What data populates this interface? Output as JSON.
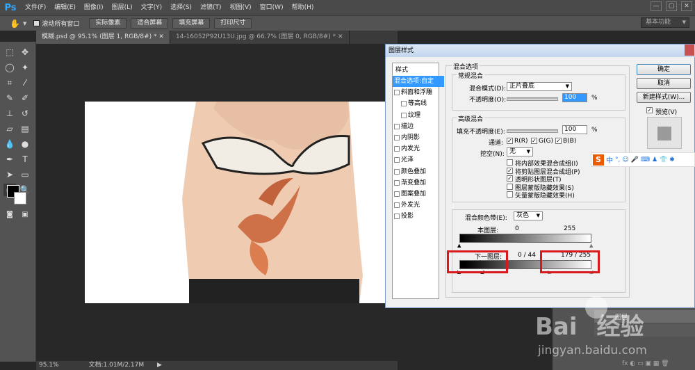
{
  "app": {
    "logo": "Ps"
  },
  "menu": [
    "文件(F)",
    "编辑(E)",
    "图像(I)",
    "图层(L)",
    "文字(Y)",
    "选择(S)",
    "滤镜(T)",
    "视图(V)",
    "窗口(W)",
    "帮助(H)"
  ],
  "window_controls": [
    "—",
    "▢",
    "✕"
  ],
  "options_bar": {
    "scroll_all_label": "滚动所有窗口",
    "buttons": [
      "实际像素",
      "适合屏幕",
      "填充屏幕",
      "打印尺寸"
    ],
    "workspace": "基本功能"
  },
  "tabs": [
    {
      "label": "模糊.psd @ 95.1% (图层 1, RGB/8#) * ✕",
      "active": true
    },
    {
      "label": "14-16052P92U13U.jpg @ 66.7% (图层 0, RGB/8#) * ✕",
      "active": false
    }
  ],
  "status": {
    "zoom": "95.1%",
    "doc": "文档:1.01M/2.17M"
  },
  "dialog": {
    "title": "图层样式",
    "styles_header": "样式",
    "styles": [
      {
        "label": "混合选项:自定",
        "selected": true,
        "checkbox": false
      },
      {
        "label": "斜面和浮雕",
        "checkbox": true
      },
      {
        "label": "等高线",
        "checkbox": true,
        "indent": true
      },
      {
        "label": "纹理",
        "checkbox": true,
        "indent": true
      },
      {
        "label": "描边",
        "checkbox": true
      },
      {
        "label": "内阴影",
        "checkbox": true
      },
      {
        "label": "内发光",
        "checkbox": true
      },
      {
        "label": "光泽",
        "checkbox": true
      },
      {
        "label": "颜色叠加",
        "checkbox": true
      },
      {
        "label": "渐变叠加",
        "checkbox": true
      },
      {
        "label": "图案叠加",
        "checkbox": true
      },
      {
        "label": "外发光",
        "checkbox": true
      },
      {
        "label": "投影",
        "checkbox": true
      }
    ],
    "blend_options_title": "混合选项",
    "general": {
      "title": "常规混合",
      "mode_label": "混合模式(D):",
      "mode_value": "正片叠底",
      "opacity_label": "不透明度(O):",
      "opacity_value": "100",
      "percent": "%"
    },
    "advanced": {
      "title": "高级混合",
      "fill_label": "填充不透明度(E):",
      "fill_value": "100",
      "channels_label": "通道:",
      "channels": [
        "R(R)",
        "G(G)",
        "B(B)"
      ],
      "knockout_label": "挖空(N):",
      "knockout_value": "无",
      "checks": [
        {
          "label": "将内部效果混合成组(I)",
          "checked": false
        },
        {
          "label": "将剪贴图层混合成组(P)",
          "checked": true
        },
        {
          "label": "透明形状图层(T)",
          "checked": true
        },
        {
          "label": "图层蒙版隐藏效果(S)",
          "checked": false
        },
        {
          "label": "矢量蒙版隐藏效果(H)",
          "checked": false
        }
      ]
    },
    "blend_if": {
      "label": "混合颜色带(E):",
      "value": "灰色",
      "this_layer_label": "本图层:",
      "this_layer_values": [
        "0",
        "255"
      ],
      "underlying_label": "下一图层:",
      "underlying_low": "0 / 44",
      "underlying_high": "179 / 255"
    },
    "buttons": {
      "ok": "确定",
      "cancel": "取消",
      "new_style": "新建样式(W)...",
      "preview": "预览(V)"
    }
  },
  "ime_bar": {
    "logo": "S",
    "lang": "中"
  },
  "right_panel": {
    "tab": "填充",
    "layer_name": "图层"
  },
  "watermark": {
    "brand_1": "Bai",
    "brand_2": "经验",
    "url": "jingyan.baidu.com"
  }
}
